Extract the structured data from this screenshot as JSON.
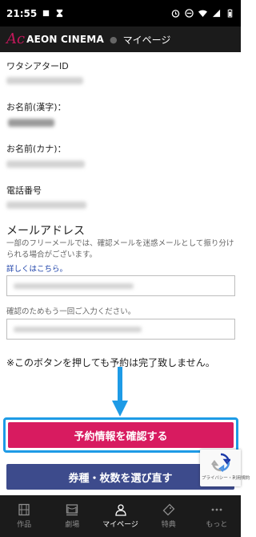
{
  "status_bar": {
    "time": "21:55"
  },
  "app_bar": {
    "logo": "Ac",
    "brand": "AEON CINEMA",
    "page_title": "マイページ"
  },
  "form": {
    "watashi_id_label": "ワタシアターID",
    "name_kanji_label": "お名前(漢字)：",
    "name_kana_label": "お名前(カナ)：",
    "phone_label": "電話番号",
    "email_label": "メールアドレス",
    "email_note": "一部のフリーメールでは、確認メールを迷惑メールとして振り分けられる場合がございます。",
    "details_link": "詳しくはこちら。",
    "confirm_note": "確認のためもう一回ご入力ください。",
    "warning": "※このボタンを押しても予約は完了致しません。"
  },
  "buttons": {
    "confirm_reservation": "予約情報を確認する",
    "reselect_tickets": "券種・枚数を選び直す"
  },
  "recaptcha": {
    "text": "プライバシー・利用規約"
  },
  "bottom_nav": {
    "items": [
      {
        "label": "作品",
        "icon": "film-icon"
      },
      {
        "label": "劇場",
        "icon": "theater-icon"
      },
      {
        "label": "マイページ",
        "icon": "person-icon"
      },
      {
        "label": "特典",
        "icon": "ticket-icon"
      },
      {
        "label": "もっと",
        "icon": "more-icon"
      }
    ],
    "active_index": 2
  },
  "colors": {
    "accent_pink": "#d81b60",
    "navy_button": "#3d4b8c",
    "highlight_blue": "#1e9be6"
  }
}
